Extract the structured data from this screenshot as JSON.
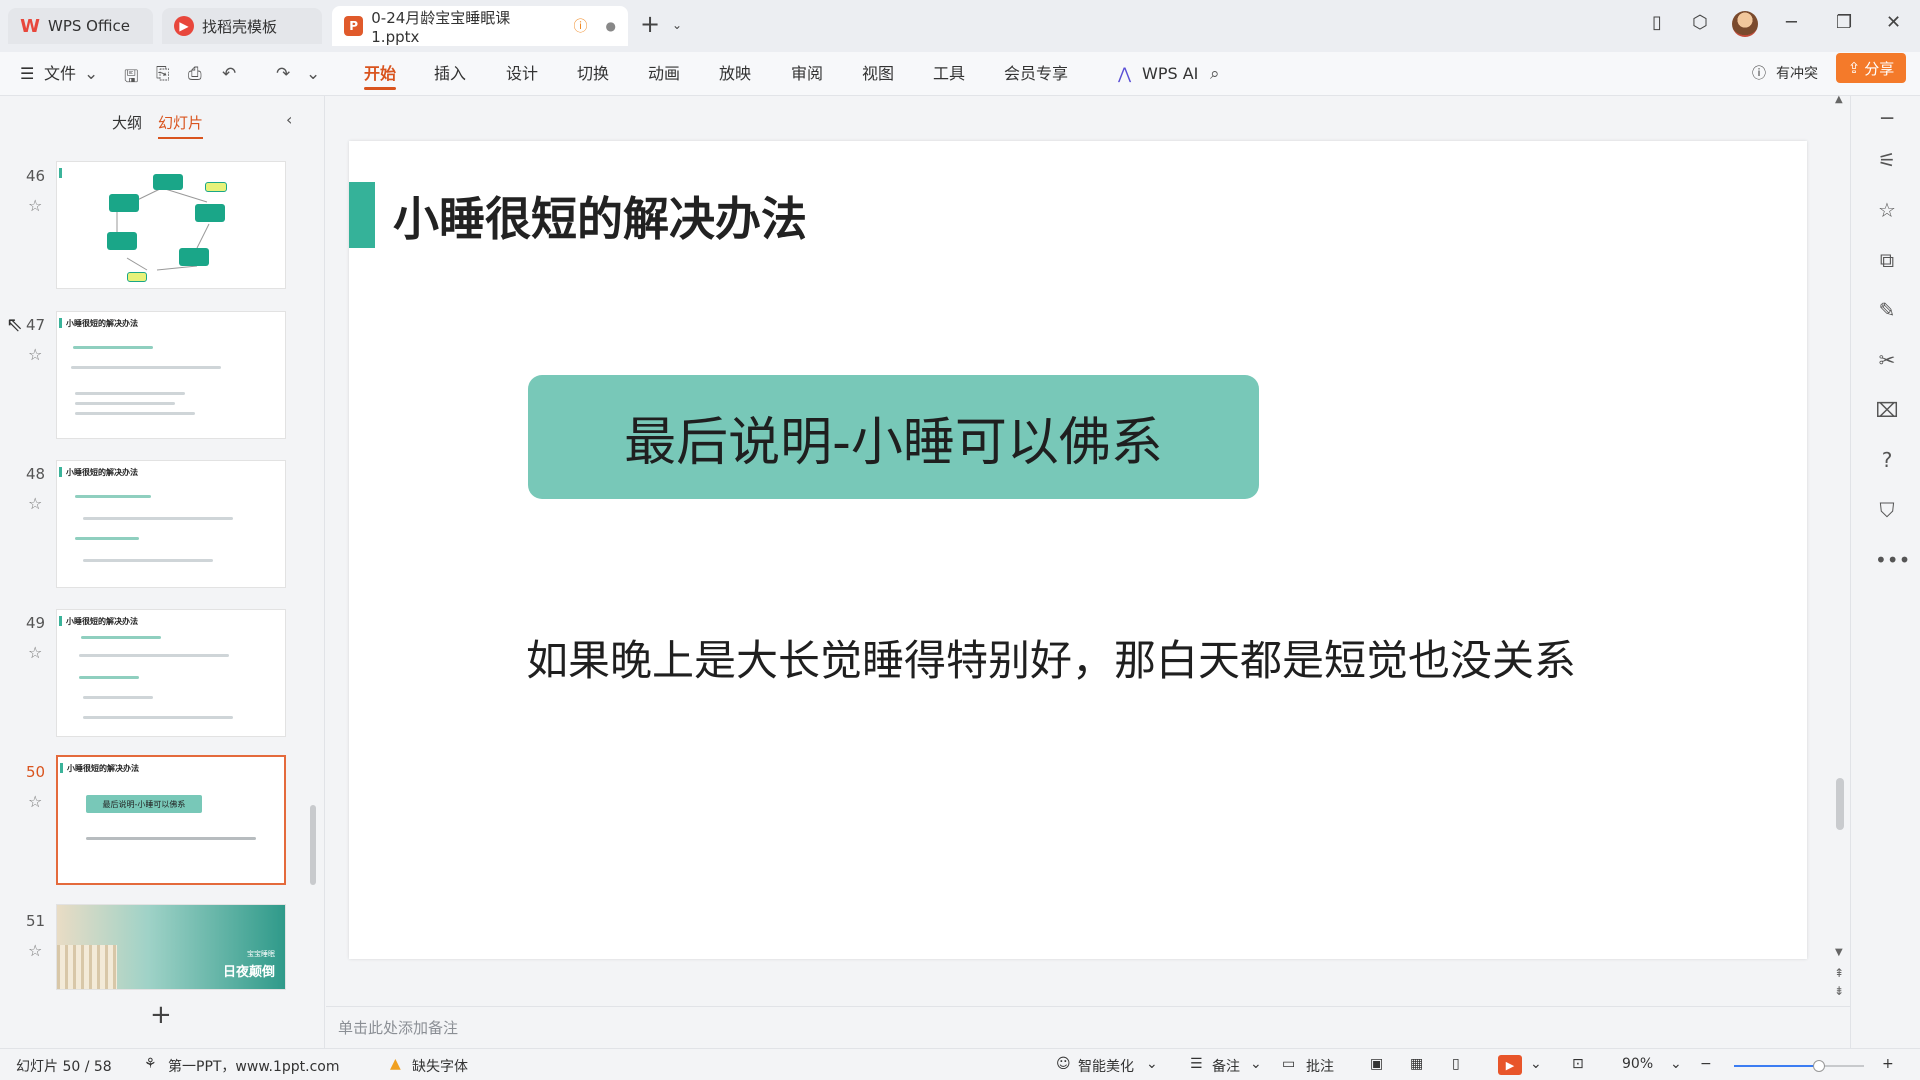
{
  "titlebar": {
    "tabs": [
      {
        "label": "WPS Office",
        "icon": "wps-logo-icon"
      },
      {
        "label": "找稻壳模板",
        "icon": "docer-icon"
      },
      {
        "label": "0-24月龄宝宝睡眠课1.pptx",
        "icon": "pptx-file-icon",
        "icon_text": "P"
      }
    ],
    "add_tab": "+",
    "window_controls": [
      "─",
      "❐",
      "✕"
    ]
  },
  "ribbon": {
    "menu_label": "文件",
    "tabs": [
      "开始",
      "插入",
      "设计",
      "切换",
      "动画",
      "放映",
      "审阅",
      "视图",
      "工具",
      "会员专享"
    ],
    "active_tab": "开始",
    "wps_ai": "WPS AI",
    "conflict": "有冲突",
    "share": "分享",
    "accent": "#d9541e"
  },
  "left_panel": {
    "tabs": [
      "大纲",
      "幻灯片"
    ],
    "active_tab": "幻灯片",
    "slides": [
      {
        "num": "46"
      },
      {
        "num": "47",
        "title": "小睡很短的解决办法"
      },
      {
        "num": "48",
        "title": "小睡很短的解决办法"
      },
      {
        "num": "49",
        "title": "小睡很短的解决办法"
      },
      {
        "num": "50",
        "title": "小睡很短的解决办法",
        "box": "最后说明-小睡可以佛系",
        "selected": true
      },
      {
        "num": "51",
        "caption1": "宝宝睡眠",
        "caption2": "日夜颠倒"
      }
    ],
    "add": "+"
  },
  "slide": {
    "title": "小睡很短的解决办法",
    "highlight": "最后说明-小睡可以佛系",
    "body": "如果晚上是大长觉睡得特别好，那白天都是短觉也没关系",
    "accent": "#35b299",
    "box_color": "#78c8b8"
  },
  "notes": {
    "placeholder": "单击此处添加备注"
  },
  "status": {
    "slide_counter": "幻灯片 50 / 58",
    "theme": "第一PPT，www.1ppt.com",
    "missing_font": "缺失字体",
    "beautify": "智能美化",
    "notes": "备注",
    "comments": "批注",
    "zoom": "90%",
    "zoom_fraction": 0.65
  }
}
